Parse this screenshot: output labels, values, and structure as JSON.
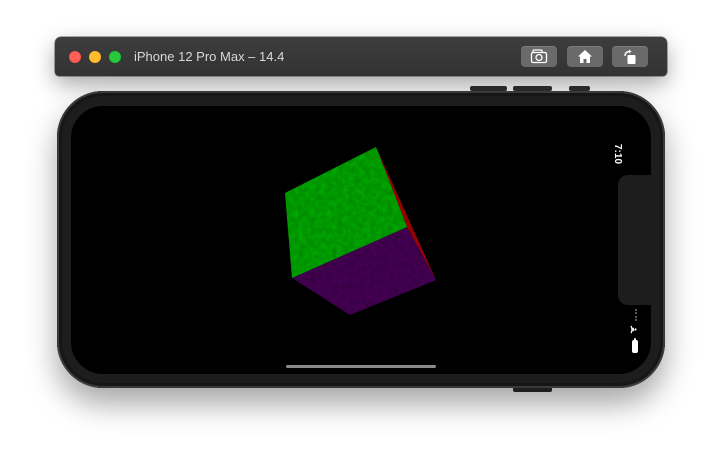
{
  "window": {
    "title": "iPhone 12 Pro Max – 14.4",
    "controls": {
      "close": "close",
      "minimize": "minimize",
      "zoom": "zoom"
    },
    "toolbar": [
      {
        "id": "screenshot",
        "icon": "camera-icon"
      },
      {
        "id": "home",
        "icon": "home-icon"
      },
      {
        "id": "rotate",
        "icon": "rotate-icon"
      }
    ]
  },
  "device": {
    "model": "iPhone 12 Pro Max",
    "orientation": "landscape",
    "status_bar": {
      "time": "7:10",
      "wifi": "wifi-icon",
      "battery": "battery-icon"
    }
  },
  "scene": {
    "object": "rotating cube",
    "faces": [
      {
        "name": "top",
        "color": "#10b010"
      },
      {
        "name": "front",
        "color": "#4c0f5a"
      },
      {
        "name": "right",
        "color": "#b00000"
      }
    ]
  }
}
